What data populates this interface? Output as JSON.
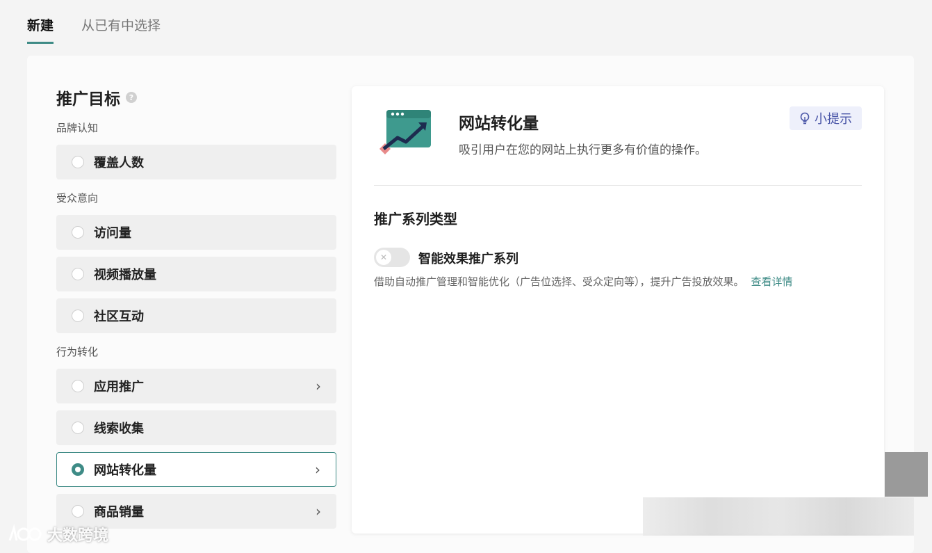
{
  "tabs": [
    {
      "label": "新建"
    },
    {
      "label": "从已有中选择"
    }
  ],
  "left": {
    "title": "推广目标",
    "help_icon": "?",
    "groups": [
      {
        "label": "品牌认知",
        "options": [
          {
            "label": "覆盖人数"
          }
        ]
      },
      {
        "label": "受众意向",
        "options": [
          {
            "label": "访问量"
          },
          {
            "label": "视频播放量"
          },
          {
            "label": "社区互动"
          }
        ]
      },
      {
        "label": "行为转化",
        "options": [
          {
            "label": "应用推广",
            "chevron": "›"
          },
          {
            "label": "线索收集"
          },
          {
            "label": "网站转化量",
            "chevron": "›",
            "selected": true
          },
          {
            "label": "商品销量",
            "chevron": "›"
          }
        ]
      }
    ]
  },
  "detail": {
    "title": "网站转化量",
    "description": "吸引用户在您的网站上执行更多有价值的操作。",
    "tip_label": "小提示",
    "section_title": "推广系列类型",
    "toggle_label": "智能效果推广系列",
    "toggle_state": "off",
    "toggle_desc": "借助自动推广管理和智能优化（广告位选择、受众定向等），提升广告投放效果。",
    "link_label": "查看详情"
  },
  "watermark": "大数跨境",
  "colors": {
    "accent": "#3e8b86",
    "tip_bg": "#eef0fb",
    "tip_text": "#4a56a8"
  }
}
